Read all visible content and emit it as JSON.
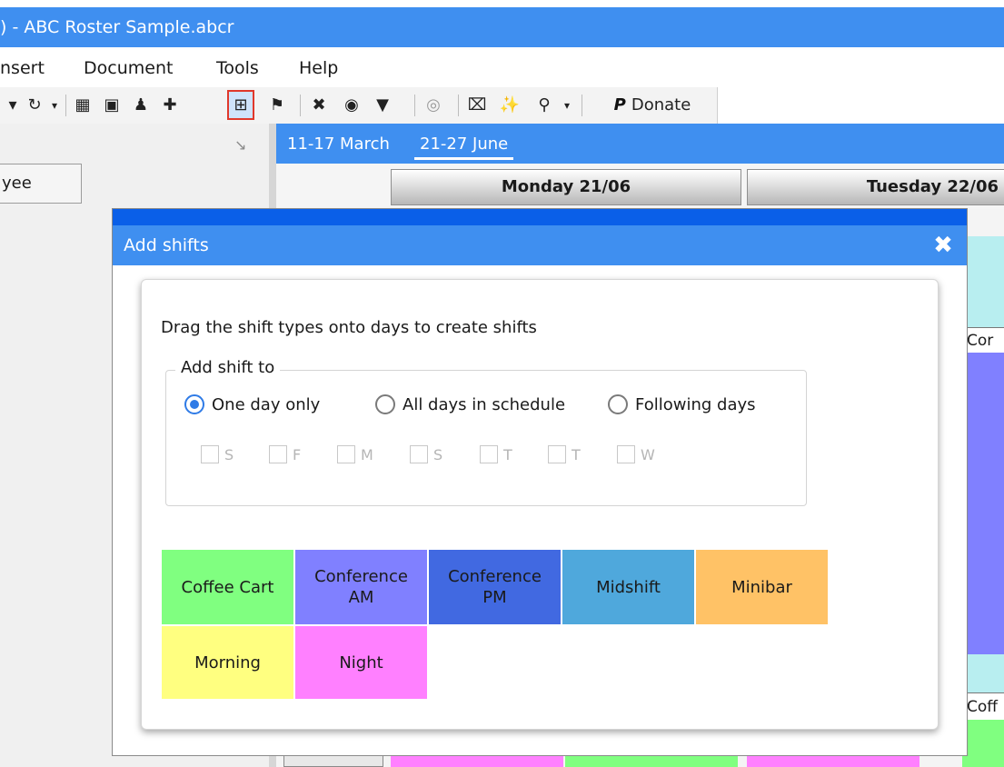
{
  "window": {
    "title": ") - ABC Roster Sample.abcr"
  },
  "menu": {
    "items": [
      "nsert",
      "Document",
      "Tools",
      "Help"
    ]
  },
  "toolbar": {
    "donate_label": "Donate"
  },
  "left_pane": {
    "employee_button": "yee"
  },
  "schedule": {
    "week_tabs": [
      "11-17 March",
      "21-27 June"
    ],
    "day_headers": [
      "Monday 21/06",
      "Tuesday 22/06"
    ],
    "partial_labels": [
      "Cor",
      "Coff"
    ]
  },
  "dialog": {
    "title": "Add shifts",
    "instruction": "Drag the shift types onto days to create shifts",
    "add_to_label": "Add shift to",
    "options": [
      {
        "label": "One day only",
        "selected": true
      },
      {
        "label": "All days in schedule",
        "selected": false
      },
      {
        "label": "Following days",
        "selected": false
      }
    ],
    "days": [
      "S",
      "F",
      "M",
      "S",
      "T",
      "T",
      "W"
    ],
    "shift_types": [
      {
        "label": "Coffee Cart",
        "color": "#80ff80"
      },
      {
        "label": "Conference AM",
        "color": "#8080ff"
      },
      {
        "label": "Conference PM",
        "color": "#4169e1"
      },
      {
        "label": "Midshift",
        "color": "#4fa8dc"
      },
      {
        "label": "Minibar",
        "color": "#ffc266"
      },
      {
        "label": "Morning",
        "color": "#ffff80"
      },
      {
        "label": "Night",
        "color": "#ff80ff"
      }
    ]
  }
}
